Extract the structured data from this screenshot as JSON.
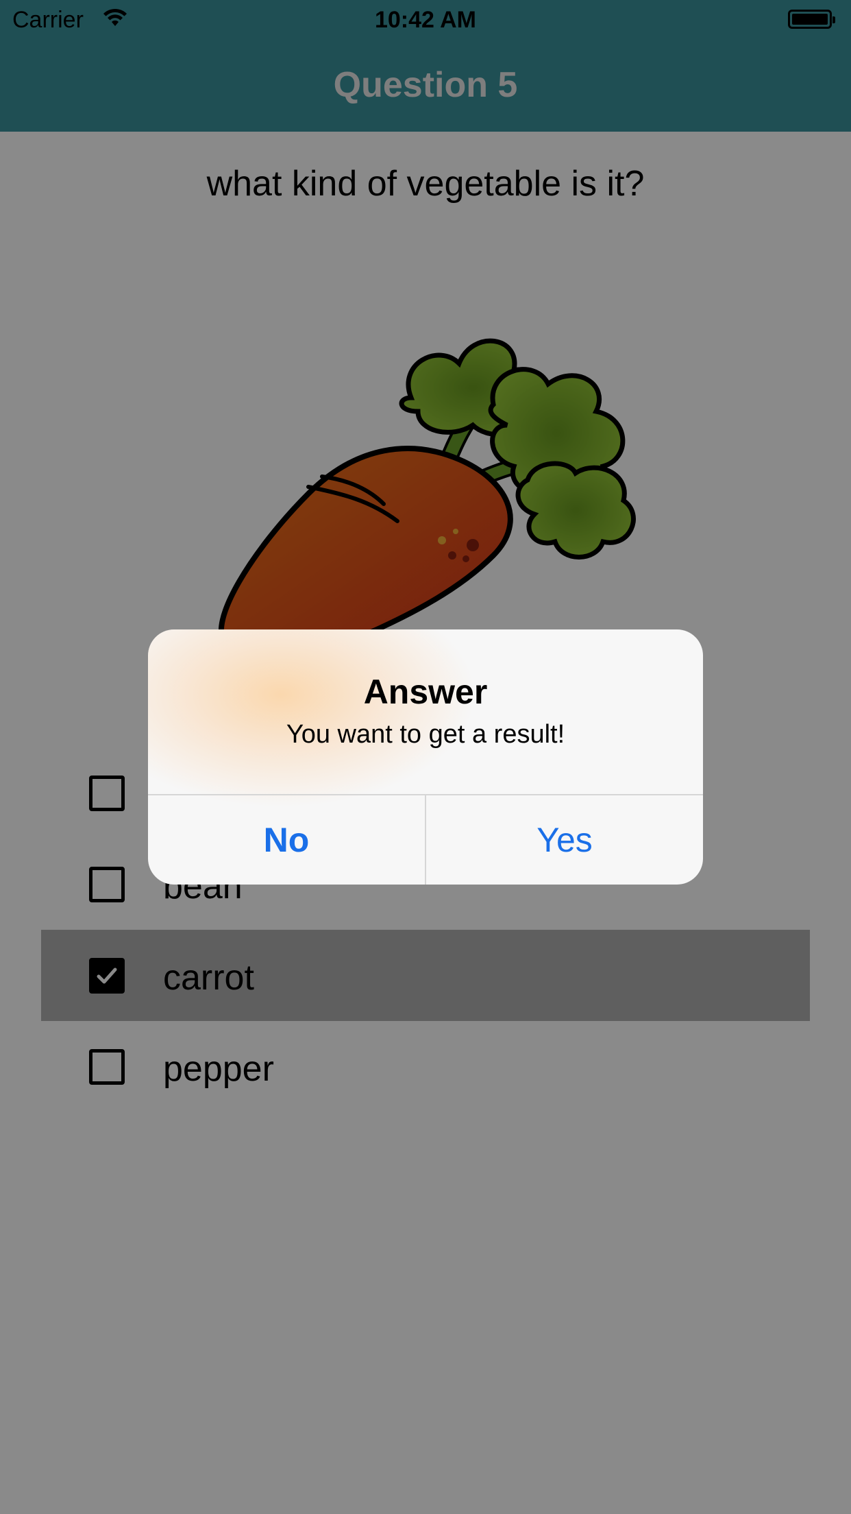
{
  "status_bar": {
    "carrier": "Carrier",
    "time": "10:42 AM"
  },
  "nav": {
    "title": "Question 5"
  },
  "question": {
    "text": "what kind of vegetable is it?"
  },
  "image": {
    "subject": "carrot-illustration"
  },
  "options": [
    {
      "label": "",
      "checked": false
    },
    {
      "label": "bean",
      "checked": false
    },
    {
      "label": "carrot",
      "checked": true
    },
    {
      "label": "pepper",
      "checked": false
    }
  ],
  "alert": {
    "title": "Answer",
    "message": "You want to get a result!",
    "no_label": "No",
    "yes_label": "Yes"
  },
  "colors": {
    "header": "#3a929b",
    "alert_button": "#1a6fe8",
    "selected_row": "#b0b0b0"
  },
  "icons": {
    "wifi": "wifi-icon",
    "battery": "battery-icon",
    "checkmark": "checkmark-icon"
  }
}
